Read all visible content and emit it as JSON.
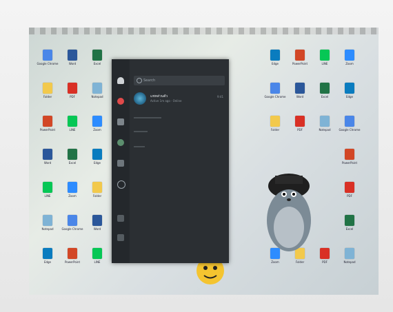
{
  "panel": {
    "search_placeholder": "Search",
    "contact_name": "แชทส่วนตัว",
    "contact_sub": "Active 1m ago · Online",
    "contact_time": "9:41"
  },
  "desktop": {
    "icons": [
      {
        "label": "Google Chrome",
        "color": "#4a86e8"
      },
      {
        "label": "Word",
        "color": "#2b579a"
      },
      {
        "label": "Excel",
        "color": "#217346"
      },
      {
        "label": "Edge",
        "color": "#0a7cbf"
      },
      {
        "label": "PowerPoint",
        "color": "#d24726"
      },
      {
        "label": "LINE",
        "color": "#06c755"
      },
      {
        "label": "Zoom",
        "color": "#2d8cff"
      },
      {
        "label": "Folder",
        "color": "#f2c94c"
      },
      {
        "label": "PDF",
        "color": "#d93025"
      },
      {
        "label": "Notepad",
        "color": "#7fb3d5"
      }
    ]
  }
}
